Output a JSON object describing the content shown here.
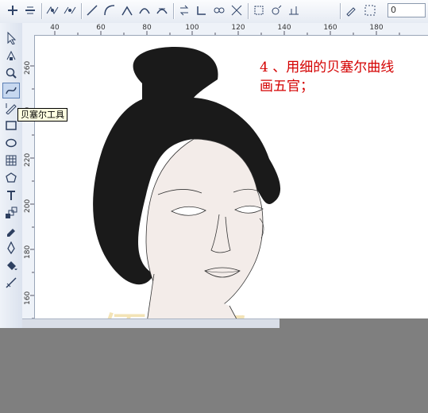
{
  "property_bar": {
    "number_value": "0",
    "icons": [
      "add-node-icon",
      "delete-node-icon",
      "join-nodes-icon",
      "break-curve-icon",
      "to-line-icon",
      "to-curve-icon",
      "cusp-icon",
      "smooth-icon",
      "symmetrical-icon",
      "reverse-direction-icon",
      "extend-curve-icon",
      "extract-subpath-icon",
      "stretch-nodes-icon",
      "rotate-nodes-icon",
      "align-nodes-icon",
      "elastic-mode-icon",
      "select-all-nodes-icon"
    ]
  },
  "toolbox": {
    "tools": [
      "pick-tool-icon",
      "shape-tool-icon",
      "zoom-tool-icon",
      "bezier-tool-icon",
      "smart-drawing-tool-icon",
      "rectangle-tool-icon",
      "ellipse-tool-icon",
      "table-tool-icon",
      "polygon-tool-icon",
      "text-tool-icon",
      "interactive-blend-tool-icon",
      "eyedropper-tool-icon",
      "outline-pen-tool-icon",
      "fill-tool-icon",
      "interactive-fill-tool-icon"
    ],
    "active_tool_tooltip": "贝塞尔工具"
  },
  "ruler_h": {
    "labels": [
      "40",
      "60",
      "80",
      "100",
      "120",
      "140",
      "160",
      "180"
    ]
  },
  "ruler_v": {
    "labels": [
      "260",
      "240",
      "220",
      "200",
      "180",
      "160"
    ]
  },
  "canvas": {
    "instruction_line1": "4 、用细的贝塞尔曲线",
    "instruction_line2": "画五官；",
    "watermark": "優 錄"
  },
  "colors": {
    "hair": "#1a1a1a",
    "skin": "#f3ece9",
    "instruction": "#d40000"
  }
}
